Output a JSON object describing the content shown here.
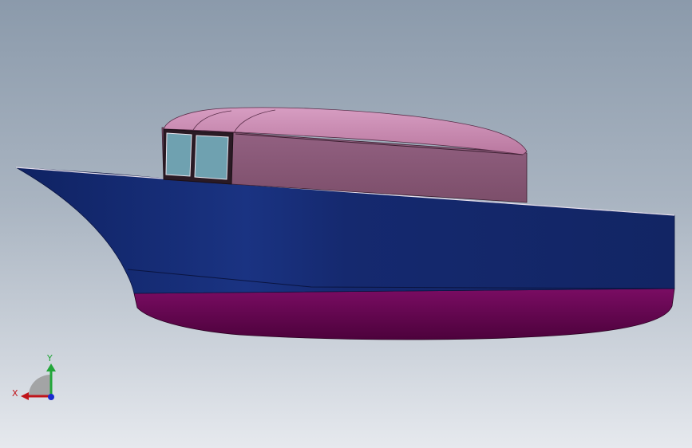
{
  "viewport": {
    "background_top": "#8b9aab",
    "background_bottom": "#e6e9ee"
  },
  "model": {
    "hull_color": "#14286b",
    "bottom_color": "#5a0348",
    "cabin_color": "#8a5a74",
    "cabin_roof_color": "#c98bb3",
    "window_color": "#6fa1b0"
  },
  "triad": {
    "y_label": "Y",
    "x_label": "X",
    "y_color": "#22a63a",
    "x_color": "#c0141a",
    "z_color": "#1a2bcf"
  }
}
